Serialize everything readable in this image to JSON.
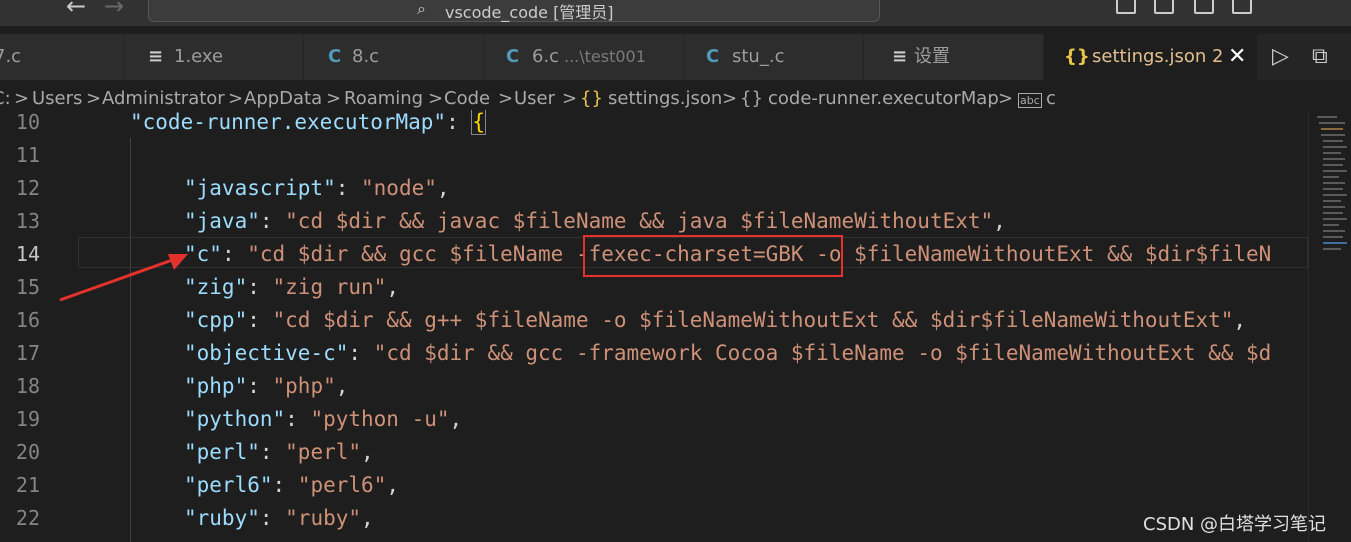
{
  "titlebar": {
    "back_glyph": "←",
    "forward_glyph": "→",
    "search_glyph": "⌕",
    "title": "vscode_code [管理员]"
  },
  "tabs": [
    {
      "icon": "c-icon",
      "label": "7.c",
      "active": false
    },
    {
      "icon": "menu-icon",
      "glyph": "≡",
      "label": "1.exe",
      "active": false
    },
    {
      "icon": "c-icon",
      "glyph": "C",
      "label": "8.c",
      "active": false
    },
    {
      "icon": "c-icon",
      "glyph": "C",
      "label": "6.c",
      "description": "...\\test001",
      "active": false
    },
    {
      "icon": "c-icon",
      "glyph": "C",
      "label": "stu_.c",
      "active": false
    },
    {
      "icon": "menu-icon",
      "glyph": "≡",
      "label": "设置",
      "active": false
    },
    {
      "icon": "json-icon",
      "glyph": "{}",
      "label": "settings.json 2",
      "active": true
    }
  ],
  "tab_close_glyph": "✕",
  "tab_actions": {
    "run_glyph": "▷",
    "open_changes_glyph": "⧉"
  },
  "breadcrumb": [
    "C:",
    ">",
    "Users",
    ">",
    "Administrator",
    ">",
    "AppData",
    ">",
    "Roaming",
    ">",
    "Code",
    ">",
    "User",
    ">",
    "{}",
    "settings.json",
    ">",
    "{}",
    "code-runner.executorMap",
    ">",
    "abc",
    "c"
  ],
  "code_lines": [
    {
      "num": "10",
      "key": "\"code-runner.executorMap\"",
      "sep": ": ",
      "val": "",
      "tail": "{"
    },
    {
      "num": "11",
      "key": "",
      "sep": "",
      "val": "",
      "tail": ""
    },
    {
      "num": "12",
      "key": "\"javascript\"",
      "sep": ": ",
      "val": "\"node\"",
      "tail": ","
    },
    {
      "num": "13",
      "key": "\"java\"",
      "sep": ": ",
      "val": "\"cd $dir && javac $fileName && java $fileNameWithoutExt\"",
      "tail": ","
    },
    {
      "num": "14",
      "key": "\"c\"",
      "sep": ": ",
      "val": "\"cd $dir && gcc $fileName -fexec-charset=GBK -o $fileNameWithoutExt && $dir$fileN",
      "tail": ""
    },
    {
      "num": "15",
      "key": "\"zig\"",
      "sep": ": ",
      "val": "\"zig run\"",
      "tail": ","
    },
    {
      "num": "16",
      "key": "\"cpp\"",
      "sep": ": ",
      "val": "\"cd $dir && g++ $fileName -o $fileNameWithoutExt && $dir$fileNameWithoutExt\"",
      "tail": ","
    },
    {
      "num": "17",
      "key": "\"objective-c\"",
      "sep": ": ",
      "val": "\"cd $dir && gcc -framework Cocoa $fileName -o $fileNameWithoutExt && $d",
      "tail": ""
    },
    {
      "num": "18",
      "key": "\"php\"",
      "sep": ": ",
      "val": "\"php\"",
      "tail": ","
    },
    {
      "num": "19",
      "key": "\"python\"",
      "sep": ": ",
      "val": "\"python -u\"",
      "tail": ","
    },
    {
      "num": "20",
      "key": "\"perl\"",
      "sep": ": ",
      "val": "\"perl\"",
      "tail": ","
    },
    {
      "num": "21",
      "key": "\"perl6\"",
      "sep": ": ",
      "val": "\"perl6\"",
      "tail": ","
    },
    {
      "num": "22",
      "key": "\"ruby\"",
      "sep": ": ",
      "val": "\"ruby\"",
      "tail": ","
    }
  ],
  "annotation": {
    "highlight_text": "-fexec-charset=GBK",
    "color": "#e5312c"
  },
  "watermark": "CSDN @白塔学习笔记",
  "colors": {
    "key": "#9cdcfe",
    "string": "#ce9178",
    "active_tab_text": "#e2c08d",
    "c_icon": "#519aba",
    "json_icon": "#e8c547"
  }
}
